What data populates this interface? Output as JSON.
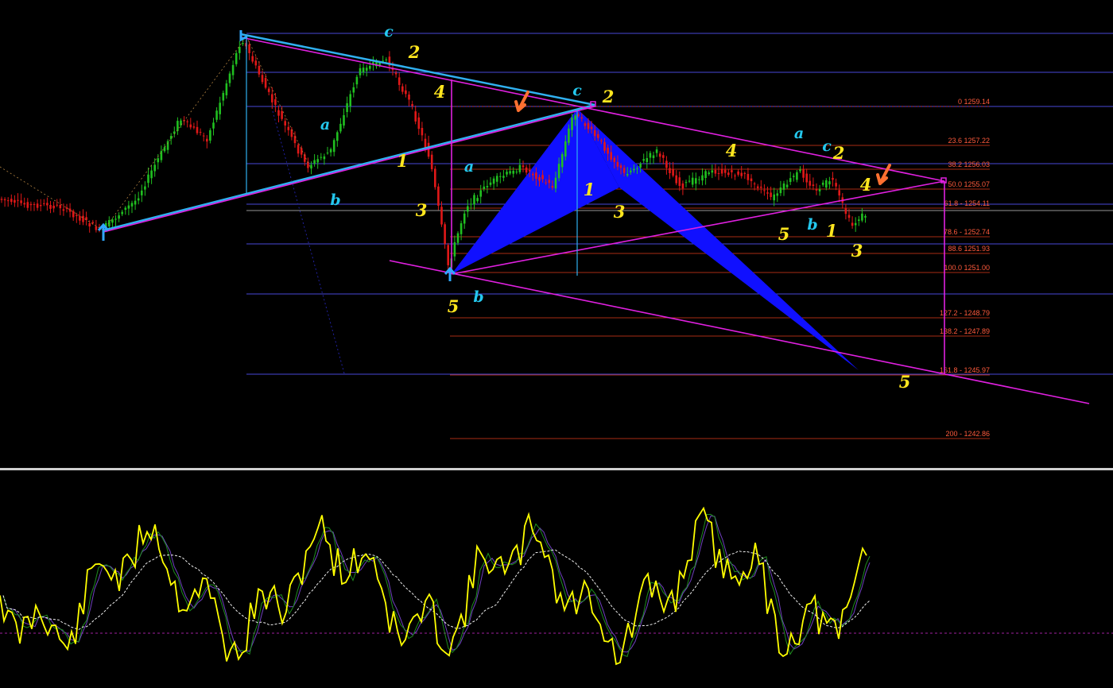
{
  "chart_data": {
    "type": "candlestick",
    "colors": {
      "background": "#000000",
      "bull_candle": "#20c020",
      "bear_candle": "#e01818",
      "trendline": "#e020e0",
      "channel": "#30b0f0",
      "pattern_fill": "#1010ff",
      "fib_line": "#e03a1a",
      "fib_text": "#ff5a3c",
      "hline": "#4848d8",
      "wave_numbers": "#ffe61e",
      "wave_letters": "#24c8ee",
      "oscillator_main": "#ffff00",
      "oscillator_signal": "#1e8c1e",
      "oscillator_slow": "#7040c0",
      "oscillator_average": "#f0f0f0",
      "zero_line": "#a020a0",
      "arrows": "#ff7030"
    },
    "fib_levels": [
      {
        "label": "0 1259.14"
      },
      {
        "label": "23.6 1257.22"
      },
      {
        "label": "38.2 1256.03"
      },
      {
        "label": "50.0 1255.07"
      },
      {
        "label": "61.8 - 1254.11"
      },
      {
        "label": "78.6 - 1252.74"
      },
      {
        "label": "88.6 1251.93"
      },
      {
        "label": "100.0 1251.00"
      },
      {
        "label": "127.2 - 1248.79"
      },
      {
        "label": "138.2 - 1247.89"
      },
      {
        "label": "161.8 - 1245.97"
      },
      {
        "label": "200 - 1242.86"
      }
    ],
    "wave_labels": [
      {
        "text": "c",
        "style": "letter"
      },
      {
        "text": "2",
        "style": "number"
      },
      {
        "text": "4",
        "style": "number"
      },
      {
        "text": "a",
        "style": "letter"
      },
      {
        "text": "1",
        "style": "number"
      },
      {
        "text": "b",
        "style": "letter"
      },
      {
        "text": "3",
        "style": "number"
      },
      {
        "text": "5",
        "style": "number"
      },
      {
        "text": "b",
        "style": "letter"
      },
      {
        "text": "a",
        "style": "letter"
      },
      {
        "text": "1",
        "style": "number"
      },
      {
        "text": "c",
        "style": "letter"
      },
      {
        "text": "2",
        "style": "number"
      },
      {
        "text": "3",
        "style": "number"
      },
      {
        "text": "4",
        "style": "number"
      },
      {
        "text": "a",
        "style": "letter"
      },
      {
        "text": "c",
        "style": "letter"
      },
      {
        "text": "2",
        "style": "number"
      },
      {
        "text": "4",
        "style": "number"
      },
      {
        "text": "5",
        "style": "number"
      },
      {
        "text": "b",
        "style": "letter"
      },
      {
        "text": "1",
        "style": "number"
      },
      {
        "text": "3",
        "style": "number"
      },
      {
        "text": "5",
        "style": "number"
      }
    ],
    "grid": false,
    "oscillator_pane": true
  }
}
